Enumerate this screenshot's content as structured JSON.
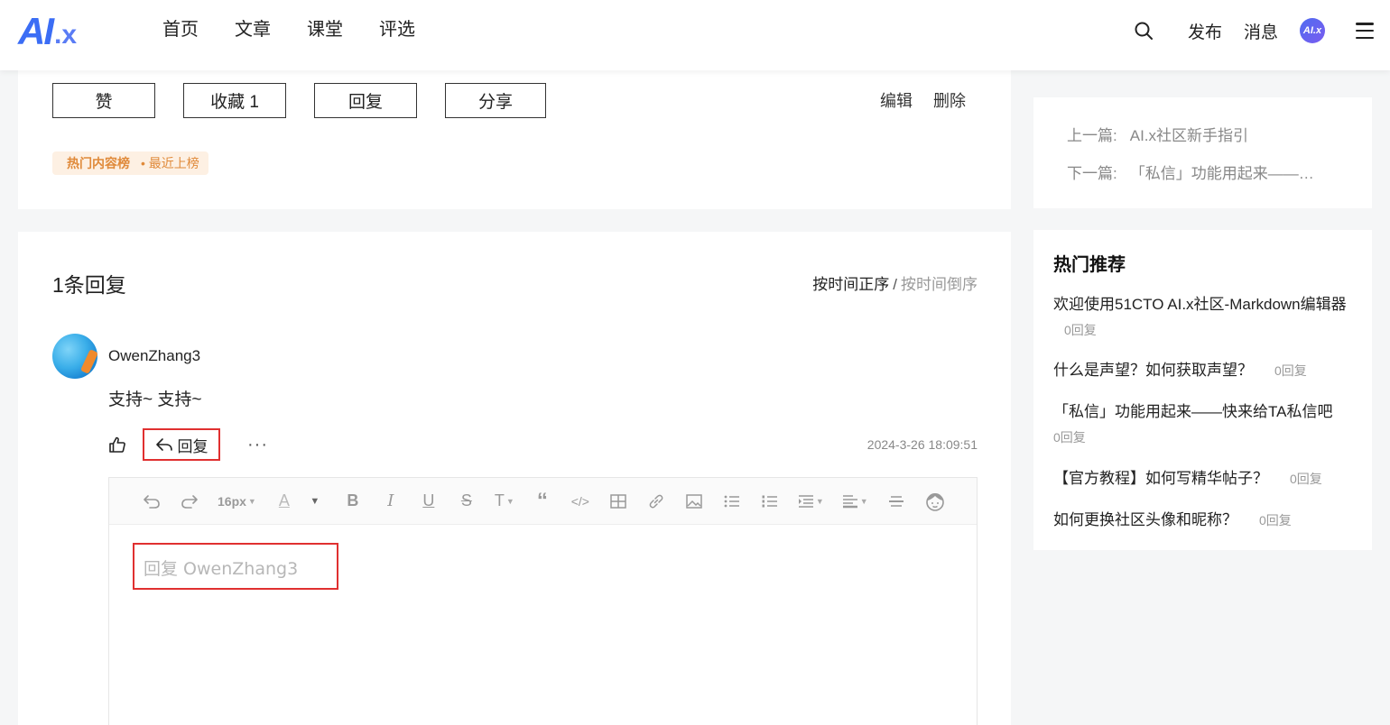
{
  "nav": {
    "logo": "AI.x",
    "items": [
      "首页",
      "文章",
      "课堂",
      "评选"
    ],
    "publish": "发布",
    "messages": "消息",
    "avatar_text": "AI.x"
  },
  "post_actions": {
    "like": "赞",
    "favorite": "收藏 1",
    "reply": "回复",
    "share": "分享",
    "edit": "编辑",
    "delete": "删除",
    "tag_main": "热门内容榜",
    "tag_sub": "• 最近上榜"
  },
  "prev_next": {
    "prev_label": "上一篇:",
    "prev_title": "AI.x社区新手指引",
    "next_label": "下一篇:",
    "next_title": "「私信」功能用起来——快来给TA私信吧"
  },
  "hot": {
    "title": "热门推荐",
    "items": [
      {
        "title": "欢迎使用51CTO AI.x社区-Markdown编辑器",
        "count": "0回复"
      },
      {
        "title": "什么是声望？如何获取声望？",
        "count": "0回复"
      },
      {
        "title": "「私信」功能用起来——快来给TA私信吧",
        "count": "0回复"
      },
      {
        "title": "【官方教程】如何写精华帖子？",
        "count": "0回复"
      },
      {
        "title": "如何更换社区头像和昵称？",
        "count": "0回复"
      }
    ]
  },
  "replies": {
    "title": "1条回复",
    "sort_asc": "按时间正序",
    "sort_sep": "/",
    "sort_desc": "按时间倒序",
    "comment": {
      "user": "OwenZhang3",
      "text": "支持~ 支持~",
      "reply_label": "回复",
      "more": "···",
      "time": "2024-3-26 18:09:51"
    },
    "editor": {
      "font_size": "16px",
      "placeholder": "回复 OwenZhang3"
    }
  },
  "colors": {
    "brand": "#3b6df5",
    "highlight_border": "#e03030",
    "tag_bg": "#fdf0e3",
    "tag_text": "#e08a3a"
  }
}
